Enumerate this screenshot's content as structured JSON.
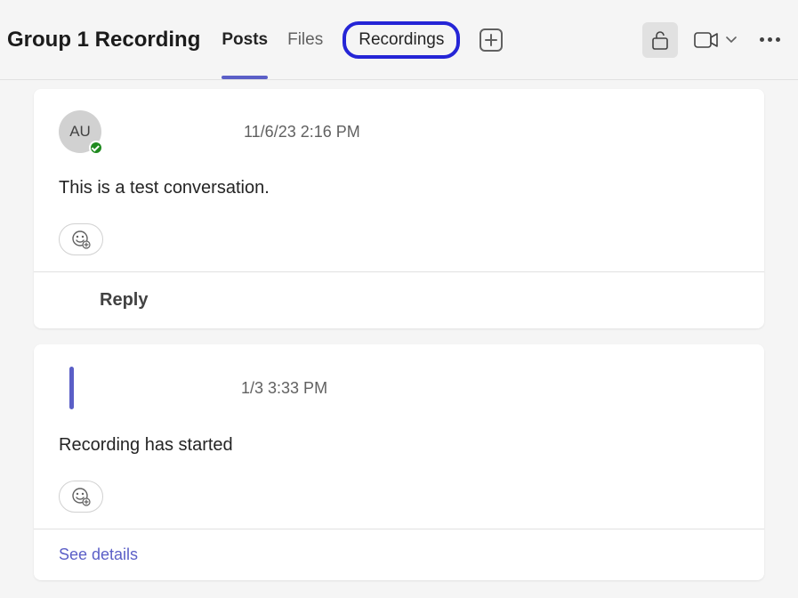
{
  "header": {
    "title": "Group 1 Recording",
    "tabs": [
      {
        "label": "Posts",
        "active": true
      },
      {
        "label": "Files"
      },
      {
        "label": "Recordings",
        "highlighted": true
      }
    ]
  },
  "posts": [
    {
      "avatar_initials": "AU",
      "timestamp": "11/6/23 2:16 PM",
      "body": "This is a test conversation.",
      "reply_label": "Reply"
    },
    {
      "timestamp": "1/3 3:33 PM",
      "body": "Recording has started",
      "details_label": "See details"
    }
  ]
}
